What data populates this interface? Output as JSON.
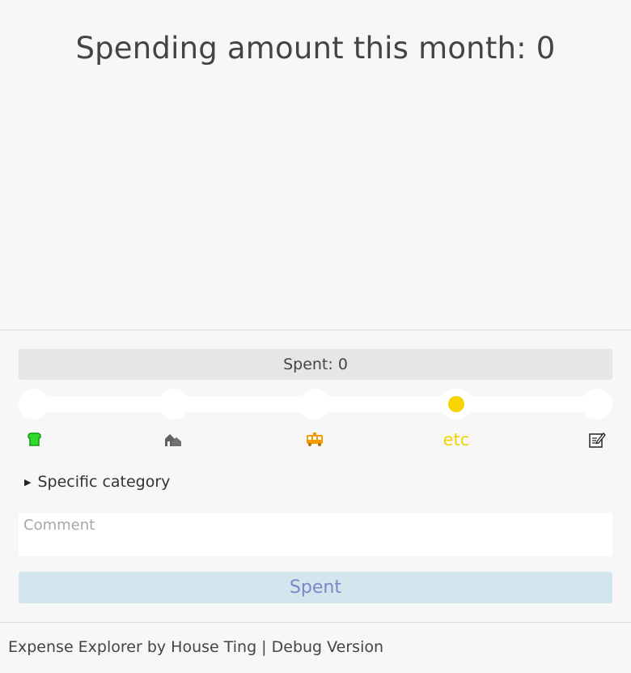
{
  "header": {
    "title": "Spending amount this month: 0"
  },
  "spent_display": {
    "text": "Spent: 0"
  },
  "categories": {
    "selected": "etc",
    "items": [
      {
        "key": "food",
        "icon": "bread-icon",
        "glyph": "🍞",
        "color": "#22dd22"
      },
      {
        "key": "housing",
        "icon": "house-icon",
        "glyph": "🏘",
        "color": "#555555"
      },
      {
        "key": "transport",
        "icon": "bus-icon",
        "glyph": "🚃",
        "color": "#f59b00"
      },
      {
        "key": "etc",
        "icon": "etc-text",
        "label": "etc",
        "color": "#f2d200"
      },
      {
        "key": "custom",
        "icon": "memo-icon",
        "glyph": "📝",
        "color": "#222222"
      }
    ]
  },
  "specific_category": {
    "label": "Specific category"
  },
  "comment": {
    "placeholder": "Comment",
    "value": ""
  },
  "submit": {
    "label": "Spent"
  },
  "footer": {
    "text": "Expense Explorer by House Ting | Debug Version"
  }
}
